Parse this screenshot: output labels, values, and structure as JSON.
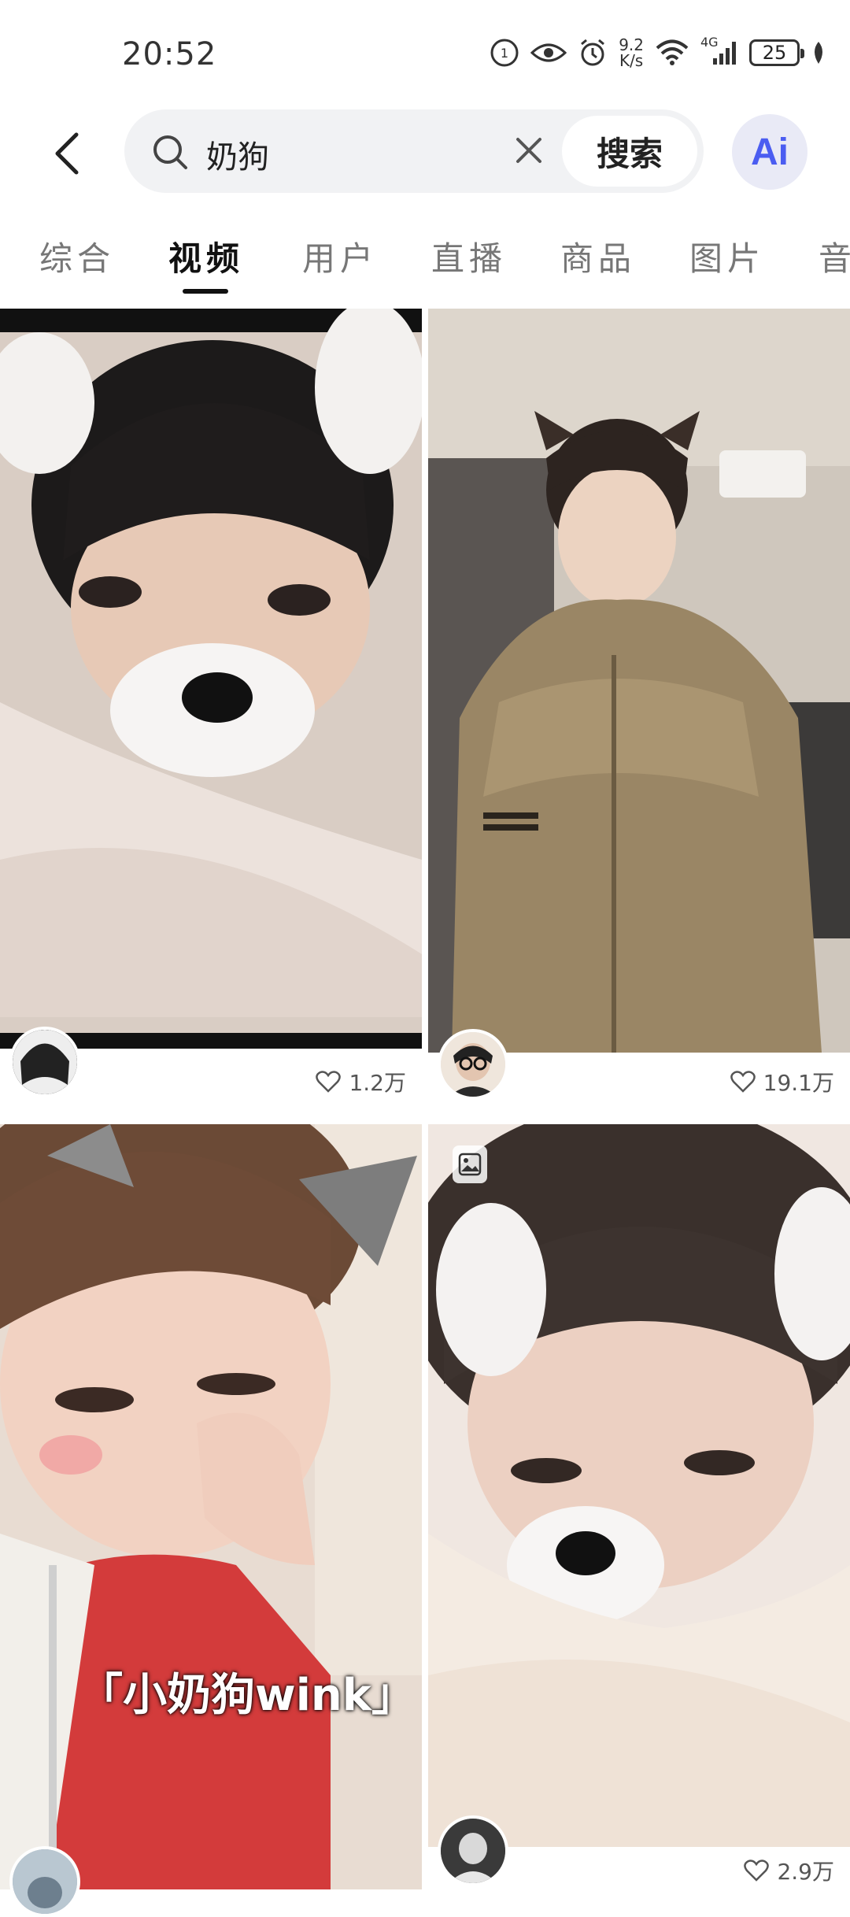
{
  "status_bar": {
    "time": "20:52",
    "net_speed_value": "9.2",
    "net_speed_unit": "K/s",
    "network_type": "4G",
    "battery": "25"
  },
  "search": {
    "query": "奶狗",
    "button_label": "搜索",
    "ai_label": "Ai"
  },
  "tabs": [
    {
      "label": "综合",
      "active": false
    },
    {
      "label": "视频",
      "active": true
    },
    {
      "label": "用户",
      "active": false
    },
    {
      "label": "直播",
      "active": false
    },
    {
      "label": "商品",
      "active": false
    },
    {
      "label": "图片",
      "active": false
    },
    {
      "label": "音",
      "active": false
    }
  ],
  "results": [
    {
      "likes": "1.2万",
      "thumb": "boy-dog-filter-blanket"
    },
    {
      "likes": "19.1万",
      "thumb": "boy-puffer-jacket-cat-ears"
    },
    {
      "likes": "",
      "thumb": "boy-wink-red-jacket",
      "caption": "「小奶狗wink」"
    },
    {
      "likes": "2.9万",
      "thumb": "boy-dog-filter-pillow",
      "photo_badge": true
    }
  ],
  "colors": {
    "accent": "#4b5df1",
    "search_bg": "#f1f2f4",
    "active_tab": "#111111",
    "inactive_tab": "#777777"
  }
}
